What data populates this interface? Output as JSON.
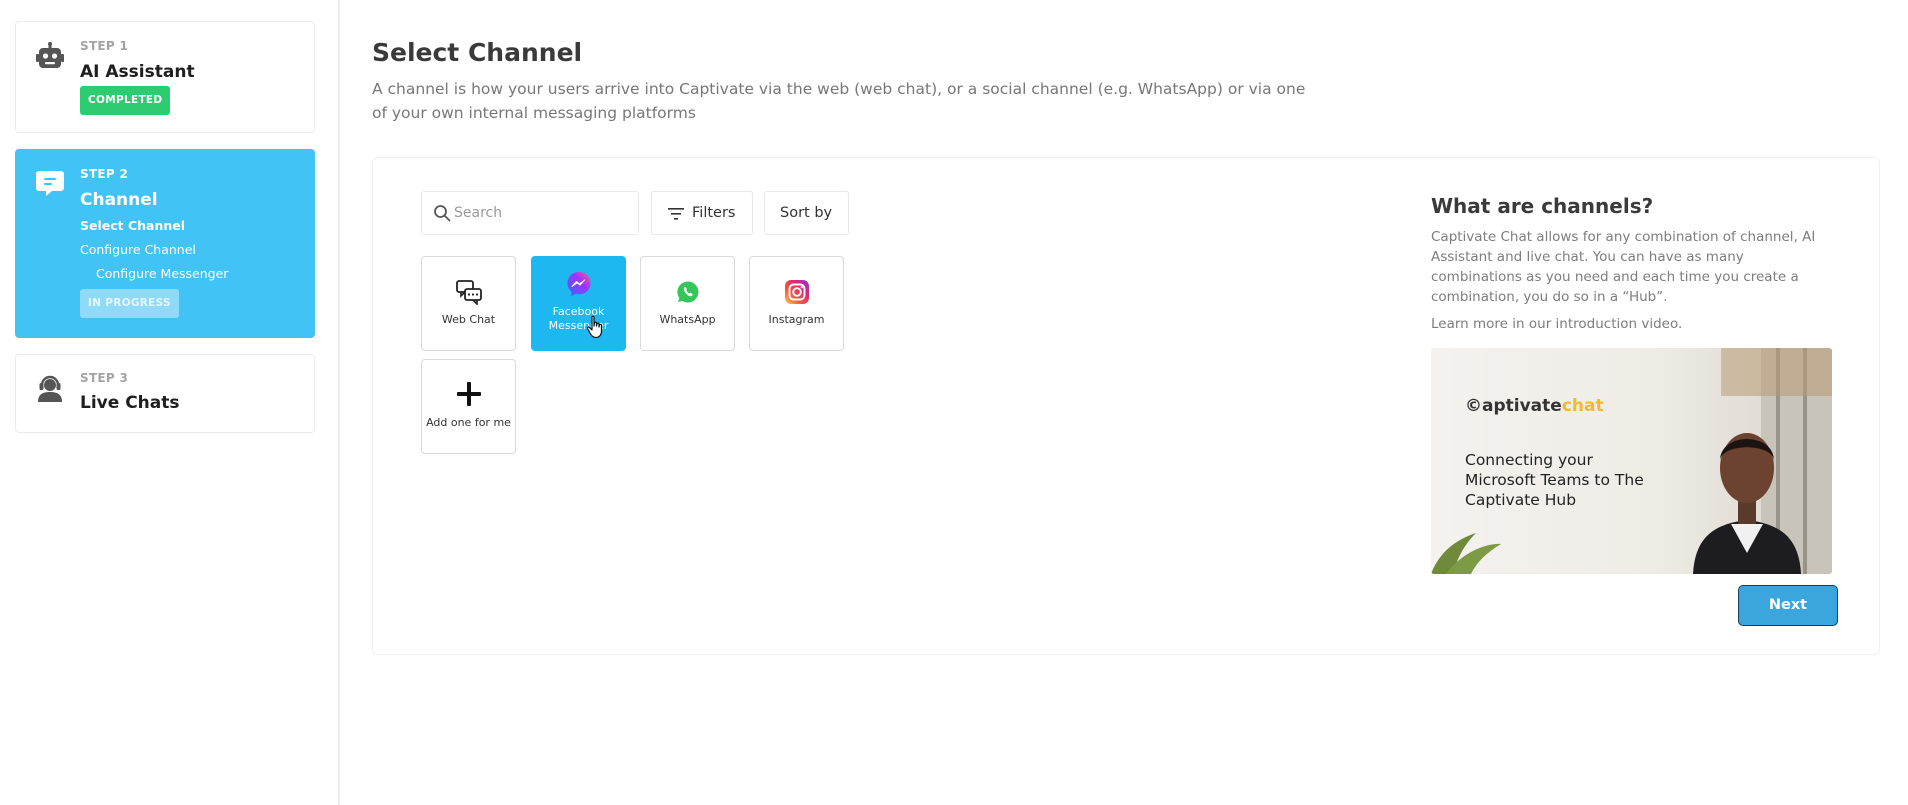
{
  "sidebar": {
    "steps": [
      {
        "label": "STEP 1",
        "title": "AI Assistant",
        "badge": "COMPLETED",
        "icon": "robot-icon"
      },
      {
        "label": "STEP 2",
        "title": "Channel",
        "badge": "IN PROGRESS",
        "icon": "chat-bubble-icon",
        "substeps": [
          "Select Channel",
          "Configure Channel",
          "Configure Messenger"
        ]
      },
      {
        "label": "STEP 3",
        "title": "Live Chats",
        "icon": "headset-agent-icon"
      }
    ]
  },
  "main": {
    "title": "Select Channel",
    "description": "A channel is how your users arrive into Captivate via the web (web chat), or a social channel (e.g. WhatsApp) or via one of your own internal messaging platforms"
  },
  "toolbar": {
    "search_placeholder": "Search",
    "filters_label": "Filters",
    "sort_label": "Sort by"
  },
  "channels": [
    {
      "label": "Web Chat",
      "icon": "web-chat-icon",
      "selected": false
    },
    {
      "label": "Facebook Messenger",
      "icon": "messenger-icon",
      "selected": true
    },
    {
      "label": "WhatsApp",
      "icon": "whatsapp-icon",
      "selected": false
    },
    {
      "label": "Instagram",
      "icon": "instagram-icon",
      "selected": false
    },
    {
      "label": "Add one for me",
      "icon": "plus-icon",
      "selected": false
    }
  ],
  "info": {
    "title": "What are channels?",
    "text": "Captivate Chat allows for any combination of channel, AI Assistant and live chat. You can have as many combinations as you need and each time you create a combination, you do so in a “Hub”.",
    "link_text": "Learn more in our introduction video."
  },
  "video": {
    "brand_prefix": "©aptivate",
    "brand_accent": "chat",
    "title": "Connecting your Microsoft Teams to The Captivate Hub"
  },
  "next_label": "Next",
  "colors": {
    "accent": "#41c3f5",
    "selected_tile": "#1eb8f1",
    "completed": "#2ecc71",
    "next_button": "#3ba5dd"
  }
}
